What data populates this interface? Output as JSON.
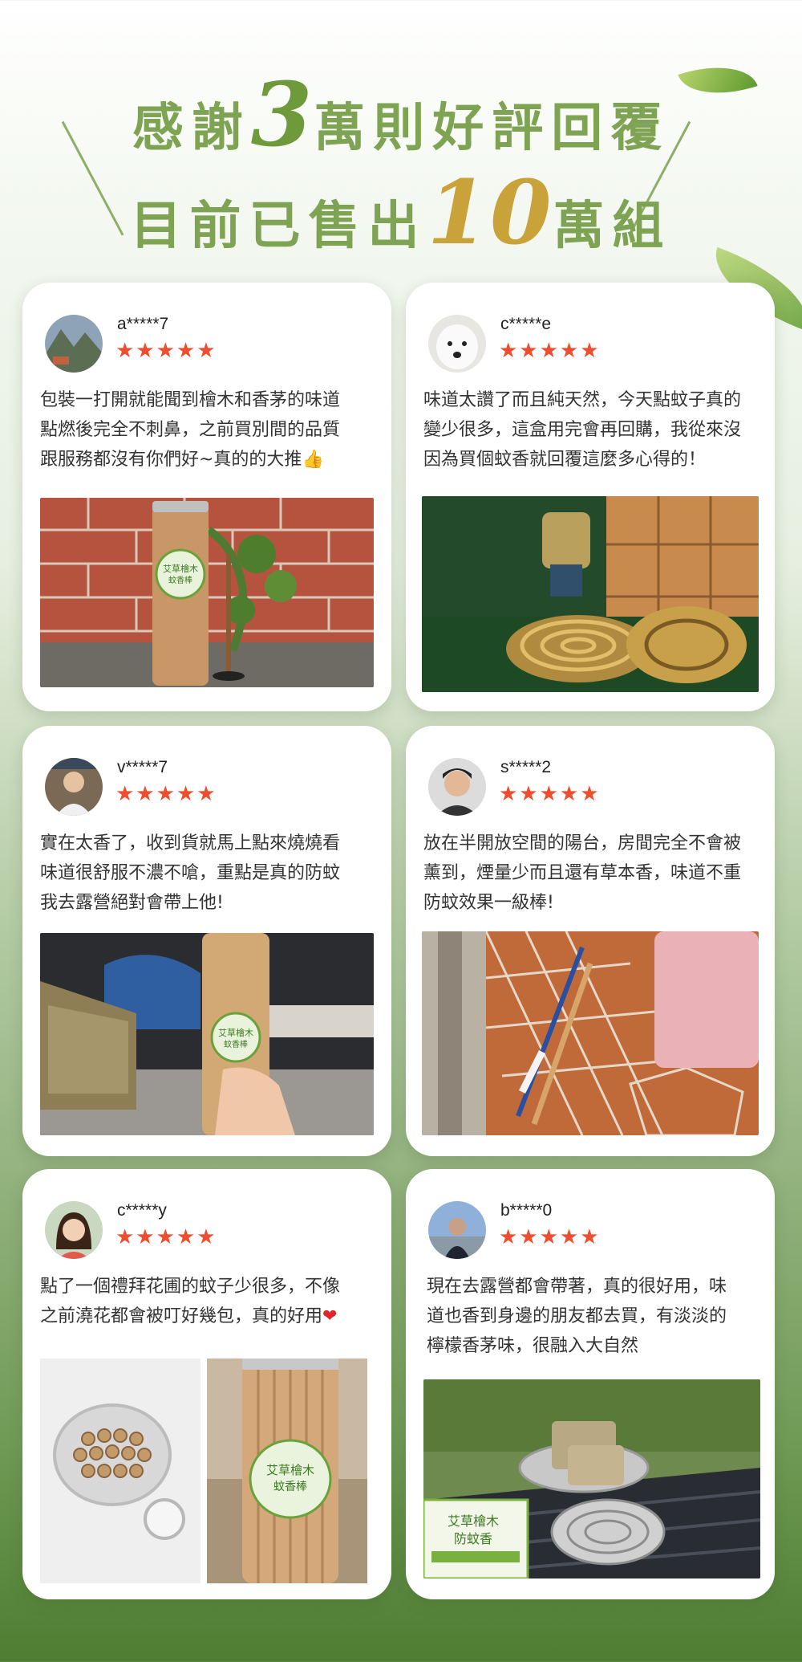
{
  "header": {
    "line1_pre": "感謝",
    "line1_num": "3",
    "line1_post": "萬則好評回覆",
    "line2_pre": "目前已售出",
    "line2_num": "10",
    "line2_post": "萬組"
  },
  "reviews": [
    {
      "user": "a*****7",
      "stars": "★★★★★",
      "text_lines": [
        "包裝一打開就能聞到檜木和香茅的味道",
        "點燃後完全不刺鼻，之前買別間的品質",
        "跟服務都沒有你們好~真的的大推"
      ],
      "emoji": "👍",
      "label_line1": "艾草檜木",
      "label_line2": "蚊香棒"
    },
    {
      "user": "c*****e",
      "stars": "★★★★★",
      "text_lines": [
        "味道太讚了而且純天然，今天點蚊子真的",
        "變少很多，這盒用完會再回購，我從來沒",
        "因為買個蚊香就回覆這麼多心得的！"
      ]
    },
    {
      "user": "v*****7",
      "stars": "★★★★★",
      "text_lines": [
        "實在太香了，收到貨就馬上點來燒燒看",
        "味道很舒服不濃不嗆，重點是真的防蚊",
        "我去露營絕對會帶上他!"
      ],
      "label_line1": "艾草檜木",
      "label_line2": "蚊香棒"
    },
    {
      "user": "s*****2",
      "stars": "★★★★★",
      "text_lines": [
        "放在半開放空間的陽台，房間完全不會被",
        "薰到，煙量少而且還有草本香，味道不重",
        "防蚊效果一級棒!"
      ]
    },
    {
      "user": "c*****y",
      "stars": "★★★★★",
      "text_lines": [
        "點了一個禮拜花圃的蚊子少很多，不像",
        "之前澆花都會被叮好幾包，真的好用"
      ],
      "emoji": "❤",
      "label_line1": "艾草檜木",
      "label_line2": "蚊香棒"
    },
    {
      "user": "b*****0",
      "stars": "★★★★★",
      "text_lines": [
        "現在去露營都會帶著，真的很好用，味",
        "道也香到身邊的朋友都去買，有淡淡的",
        "檸檬香茅味，很融入大自然"
      ],
      "label_line1": "艾草檜木",
      "label_line2": "防蚊香"
    }
  ]
}
